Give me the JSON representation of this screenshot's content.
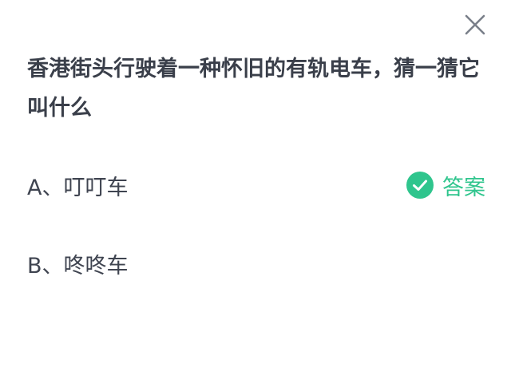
{
  "quiz": {
    "question": "香港街头行驶着一种怀旧的有轨电车，猜一猜它叫什么",
    "options": [
      {
        "text": "A、叮叮车",
        "is_answer": true
      },
      {
        "text": "B、咚咚车",
        "is_answer": false
      }
    ],
    "answer_label": "答案"
  },
  "icons": {
    "close": "close-icon",
    "check": "check-circle-icon"
  },
  "colors": {
    "accent": "#2fc58d",
    "text": "#3f4450",
    "close": "#7a7f8a"
  }
}
